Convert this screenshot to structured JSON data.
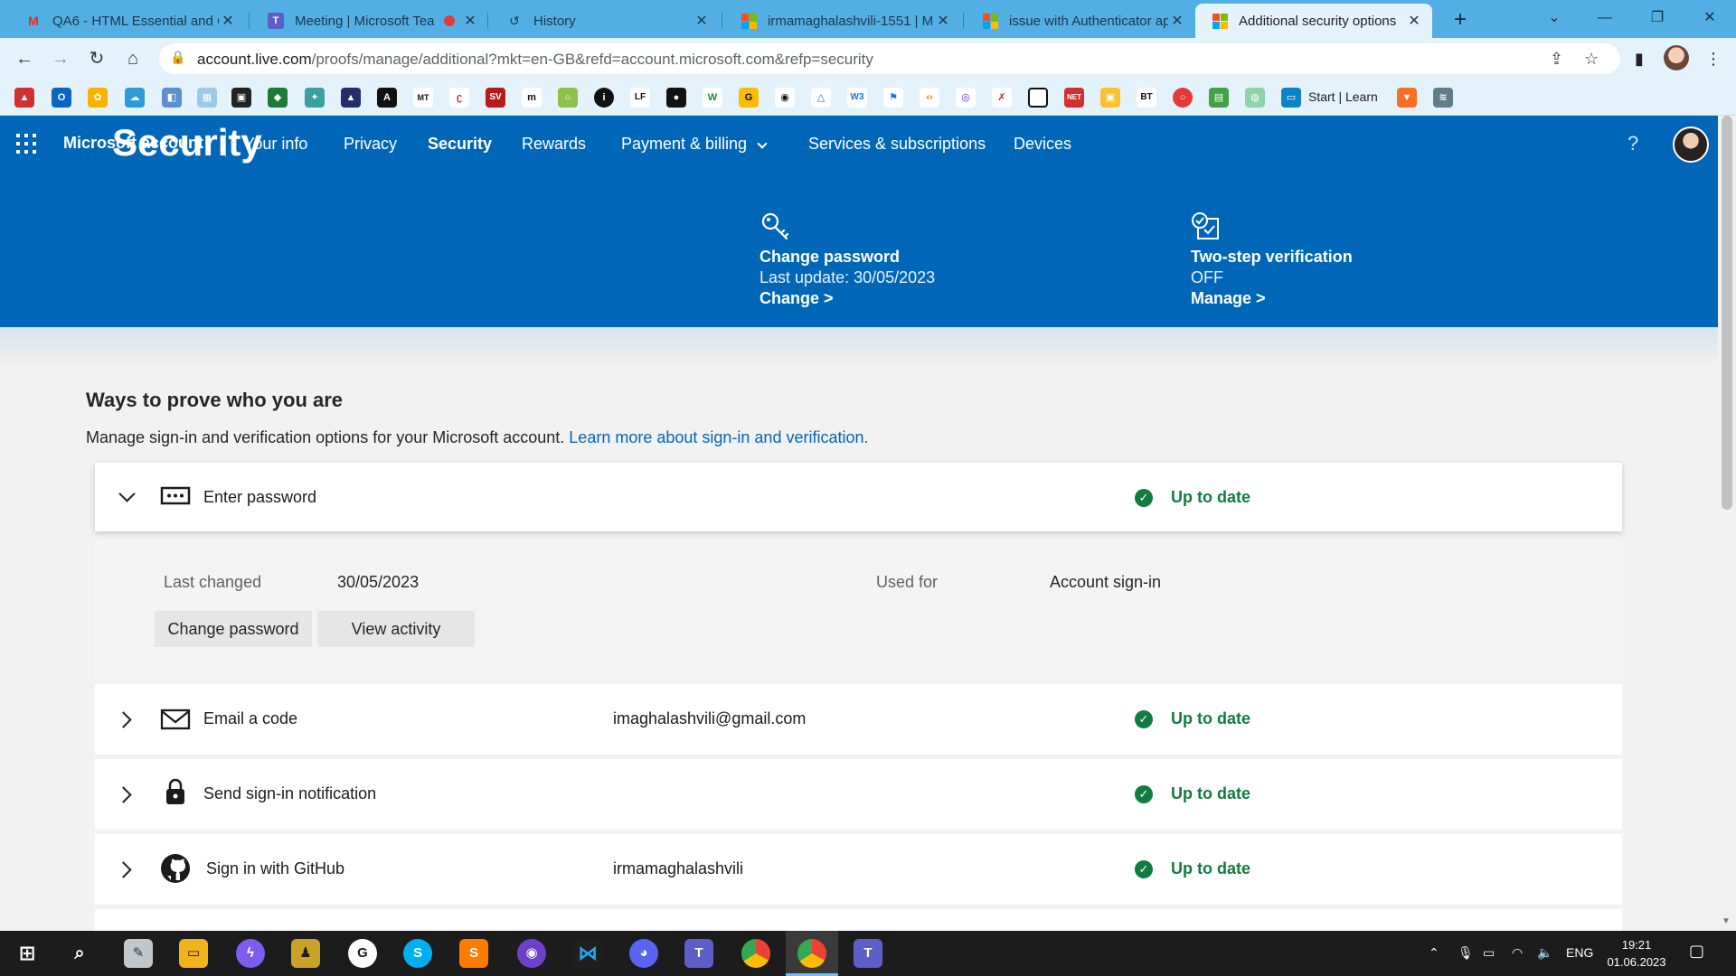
{
  "browser": {
    "tabs": [
      {
        "title": "QA6 - HTML Essential and C",
        "icon": "gmail-icon"
      },
      {
        "title": "Meeting | Microsoft Tea",
        "icon": "teams-icon"
      },
      {
        "title": "History",
        "icon": "history-icon"
      },
      {
        "title": "irmamaghalashvili-1551 | M",
        "icon": "microsoft-icon"
      },
      {
        "title": "issue with Authenticator ap",
        "icon": "microsoft-icon"
      },
      {
        "title": "Additional security options",
        "icon": "microsoft-icon"
      }
    ],
    "url_host": "account.live.com",
    "url_path": "/proofs/manage/additional?mkt=en-GB&refd=account.microsoft.com&refp=security",
    "bookmark_text": "Start | Learn"
  },
  "ms": {
    "brand": "Microsoft account",
    "nav": [
      "Your info",
      "Privacy",
      "Security",
      "Rewards",
      "Payment & billing",
      "Services & subscriptions",
      "Devices"
    ],
    "help": "?"
  },
  "hero": {
    "title": "Security",
    "change_password": {
      "title": "Change password",
      "subtitle": "Last update: 30/05/2023",
      "link": "Change >"
    },
    "two_step": {
      "title": "Two-step verification",
      "subtitle": "OFF",
      "link": "Manage >"
    }
  },
  "content": {
    "heading": "Ways to prove who you are",
    "description": "Manage sign-in and verification options for your Microsoft account.",
    "learn_link": "Learn more about sign-in and verification.",
    "rows": [
      {
        "label": "Enter password",
        "value": "",
        "status": "Up to date",
        "icon": "password-icon"
      },
      {
        "label": "Email a code",
        "value": "imaghalashvili@gmail.com",
        "status": "Up to date",
        "icon": "mail-icon"
      },
      {
        "label": "Send sign-in notification",
        "value": "",
        "status": "Up to date",
        "icon": "lock-icon"
      },
      {
        "label": "Sign in with GitHub",
        "value": "irmamaghalashvili",
        "status": "Up to date",
        "icon": "github-icon"
      }
    ],
    "detail": {
      "last_changed_label": "Last changed",
      "last_changed_value": "30/05/2023",
      "used_for_label": "Used for",
      "used_for_value": "Account sign-in",
      "change_password_btn": "Change password",
      "view_activity_btn": "View activity"
    }
  },
  "taskbar": {
    "lang": "ENG",
    "time": "19:21",
    "date": "01.06.2023"
  }
}
